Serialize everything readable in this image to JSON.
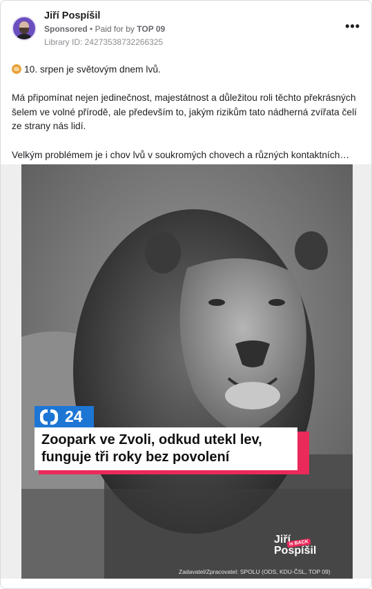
{
  "post": {
    "author": "Jiří Pospíšil",
    "sponsored_label": "Sponsored",
    "paid_prefix": "Paid for by",
    "paid_by": "TOP 09",
    "library_id": "Library ID: 24273538732266325",
    "more_label": "•••",
    "text_line1": "10. srpen je světovým dnem lvů.",
    "text_para2": "Má připomínat nejen jedinečnost, majestátnost a důležitou roli těchto překrásných šelem ve volné přírodě, ale především to, jakým rizikům tato nádherná zvířata čelí ze strany nás lidí.",
    "text_para3": "Velkým problémem je i chov lvů v soukromých chovech a různých kontaktních…"
  },
  "media": {
    "channel_number": "24",
    "headline": "Zoopark ve Zvoli, odkud utekl lev, funguje tři roky bez povolení",
    "brand_line1": "Jiří",
    "brand_line2": "Pospíšil",
    "brand_tag": "is BACK",
    "credit": "Zadavatel/Zpracovatel: SPOLU (ODS, KDU-ČSL, TOP 09)"
  },
  "colors": {
    "channel_blue": "#1e76d4",
    "accent_pink": "#ea2a5a",
    "avatar_purple": "#6b4fbf"
  },
  "icons": [
    "more-options-icon",
    "lion-emoji-icon",
    "ct24-logo-icon"
  ]
}
